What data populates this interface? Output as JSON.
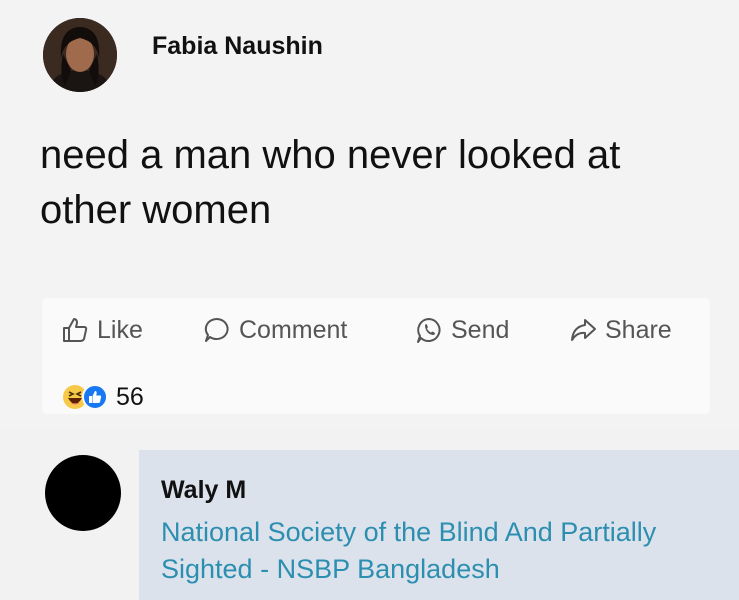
{
  "post": {
    "author": "Fabia Naushin",
    "text": "need a man who never looked at other women",
    "actions": {
      "like": "Like",
      "comment": "Comment",
      "send": "Send",
      "share": "Share"
    },
    "reactions": {
      "icons": [
        "haha-icon",
        "like-icon"
      ],
      "count": "56"
    }
  },
  "comment": {
    "author": "Waly M",
    "text": "National Society of the Blind And Partially Sighted - NSBP Bangladesh"
  },
  "colors": {
    "background": "#f2f2f2",
    "comment_bubble": "#dbe2ec",
    "link_text": "#2d8fb0",
    "action_text": "#555555",
    "like_blue": "#1877f2"
  }
}
